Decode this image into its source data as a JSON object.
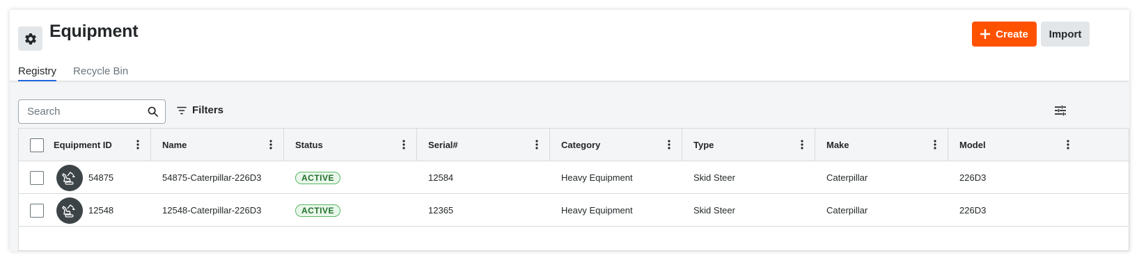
{
  "header": {
    "title": "Equipment",
    "create_label": "Create",
    "import_label": "Import"
  },
  "tabs": [
    {
      "label": "Registry",
      "active": true
    },
    {
      "label": "Recycle Bin",
      "active": false
    }
  ],
  "toolbar": {
    "search_placeholder": "Search",
    "filters_label": "Filters"
  },
  "table": {
    "columns": [
      "Equipment ID",
      "Name",
      "Status",
      "Serial#",
      "Category",
      "Type",
      "Make",
      "Model"
    ],
    "rows": [
      {
        "id": "54875",
        "name": "54875-Caterpillar-226D3",
        "status": "ACTIVE",
        "serial": "12584",
        "category": "Heavy Equipment",
        "type": "Skid Steer",
        "make": "Caterpillar",
        "model": "226D3"
      },
      {
        "id": "12548",
        "name": "12548-Caterpillar-226D3",
        "status": "ACTIVE",
        "serial": "12365",
        "category": "Heavy Equipment",
        "type": "Skid Steer",
        "make": "Caterpillar",
        "model": "226D3"
      }
    ]
  },
  "icons": {
    "tool": "gear-icon",
    "create": "plus-icon",
    "search": "search-icon",
    "filters": "filter-icon",
    "config": "sliders-icon",
    "column_menu": "kebab-icon",
    "equipment": "excavator-icon"
  },
  "colors": {
    "accent": "#ff5200",
    "tab_underline": "#2066df",
    "status_active_text": "#1f6f2b",
    "status_active_bg": "#e9f7ea"
  }
}
